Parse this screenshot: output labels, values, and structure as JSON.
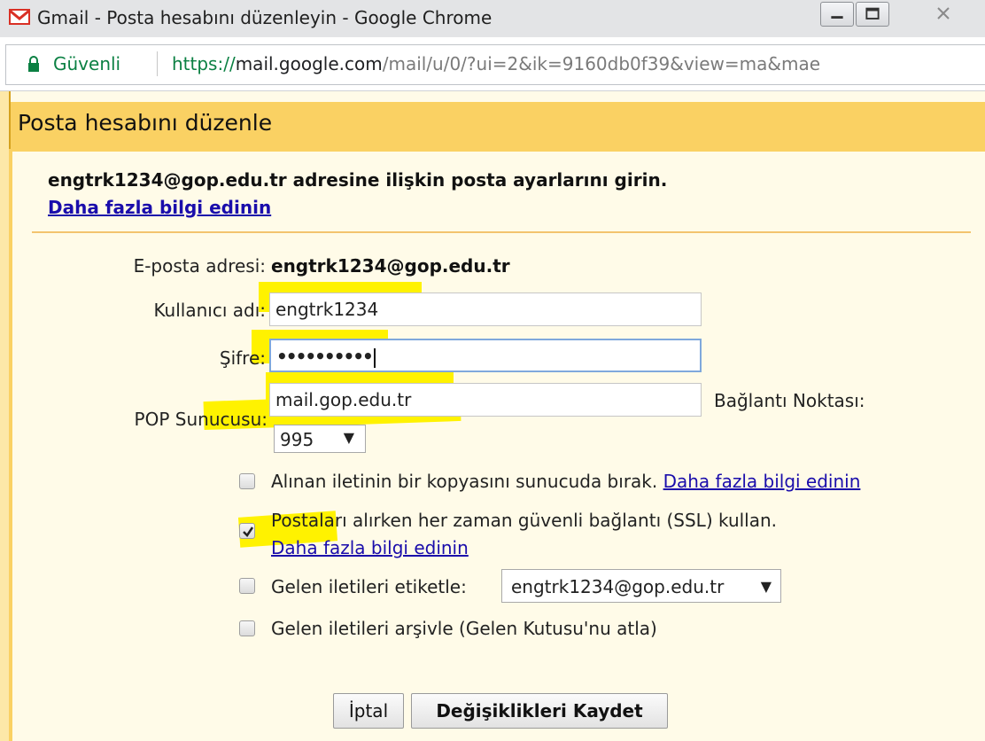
{
  "window": {
    "title": "Gmail - Posta hesabını düzenleyin - Google Chrome"
  },
  "addressbar": {
    "secure_label": "Güvenli",
    "url_scheme": "https://",
    "url_host": "mail.google.com",
    "url_rest": "/mail/u/0/?ui=2&ik=9160db0f39&view=ma&mae"
  },
  "dialog": {
    "title": "Posta hesabını düzenle",
    "intro": "engtrk1234@gop.edu.tr adresine ilişkin posta ayarlarını girin.",
    "intro_link": "Daha fazla bilgi edinin",
    "form": {
      "email_label": "E-posta adresi:",
      "email_value": "engtrk1234@gop.edu.tr",
      "username_label": "Kullanıcı adı:",
      "username_value": "engtrk1234",
      "password_label": "Şifre:",
      "password_mask": "••••••••••",
      "pop_server_label": "POP Sunucusu:",
      "pop_server_value": "mail.gop.edu.tr",
      "port_label": "Bağlantı Noktası:",
      "port_value": "995"
    },
    "options": {
      "leave_copy": {
        "label": "Alınan iletinin bir kopyasını sunucuda bırak.",
        "link": "Daha fazla bilgi edinin",
        "checked": false
      },
      "use_ssl": {
        "label": "Postaları alırken her zaman güvenli bağlantı (SSL) kullan.",
        "link": "Daha fazla bilgi edinin",
        "checked": true
      },
      "label_incoming": {
        "label": "Gelen iletileri etiketle:",
        "select_value": "engtrk1234@gop.edu.tr",
        "checked": false
      },
      "archive_incoming": {
        "label": "Gelen iletileri arşivle (Gelen Kutusu'nu atla)",
        "checked": false
      }
    },
    "buttons": {
      "cancel": "İptal",
      "save": "Değişiklikleri Kaydet"
    }
  },
  "icons": {
    "gmail": "gmail-logo-icon",
    "lock": "lock-icon",
    "minimize": "minimize-icon",
    "maximize": "maximize-icon",
    "close": "close-icon",
    "dropdown": "chevron-down-icon",
    "check": "checkmark-icon"
  },
  "colors": {
    "header_yellow": "#fad163",
    "dialog_bg": "#fffbe8",
    "highlighter": "#fff200",
    "link_blue": "#1a0dab",
    "secure_green": "#0b8043"
  }
}
